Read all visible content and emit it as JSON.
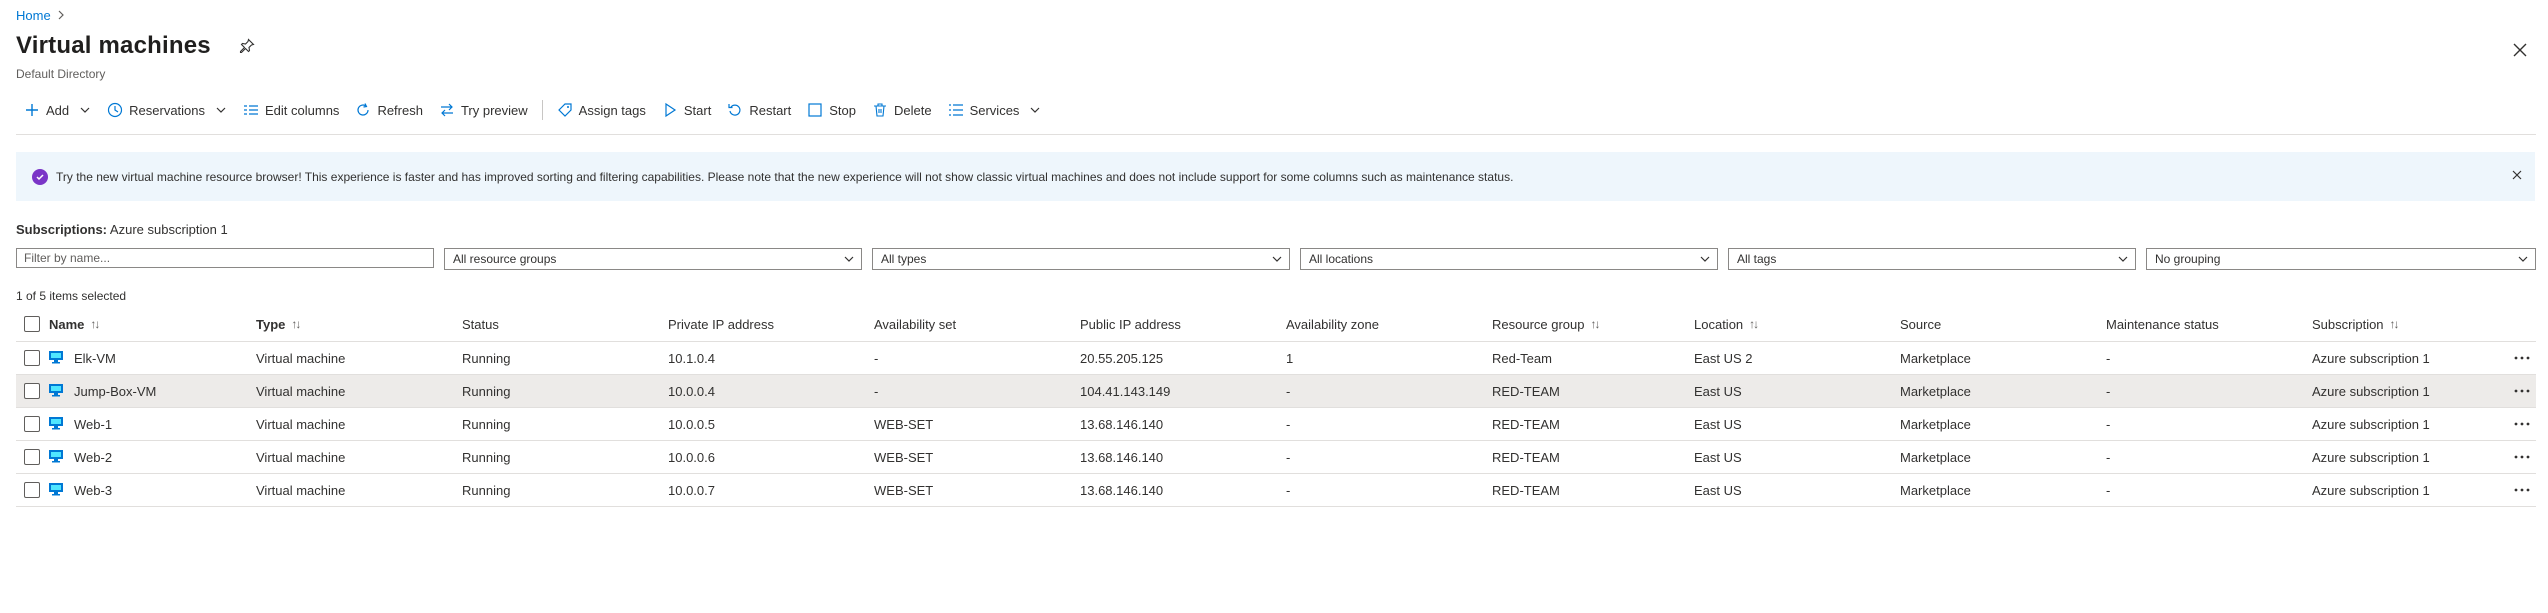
{
  "breadcrumb": {
    "home": "Home"
  },
  "header": {
    "title": "Virtual machines",
    "subtitle": "Default Directory"
  },
  "toolbar": {
    "add": "Add",
    "reservations": "Reservations",
    "edit_columns": "Edit columns",
    "refresh": "Refresh",
    "try_preview": "Try preview",
    "assign_tags": "Assign tags",
    "start": "Start",
    "restart": "Restart",
    "stop": "Stop",
    "delete": "Delete",
    "services": "Services"
  },
  "banner": {
    "text": "Try the new virtual machine resource browser! This experience is faster and has improved sorting and filtering capabilities. Please note that the new experience will not show classic virtual machines and does not include support for some columns such as maintenance status."
  },
  "subscriptions": {
    "label": "Subscriptions:",
    "value": "Azure subscription 1"
  },
  "filters": {
    "name_placeholder": "Filter by name...",
    "resource_groups": "All resource groups",
    "types": "All types",
    "locations": "All locations",
    "tags": "All tags",
    "grouping": "No grouping"
  },
  "selection": {
    "count_text": "1 of 5 items selected"
  },
  "table": {
    "headers": {
      "name": "Name",
      "type": "Type",
      "status": "Status",
      "private_ip": "Private IP address",
      "availability_set": "Availability set",
      "public_ip": "Public IP address",
      "availability_zone": "Availability zone",
      "resource_group": "Resource group",
      "location": "Location",
      "source": "Source",
      "maintenance_status": "Maintenance status",
      "subscription": "Subscription"
    },
    "rows": [
      {
        "name": "Elk-VM",
        "type": "Virtual machine",
        "status": "Running",
        "private_ip": "10.1.0.4",
        "availability_set": "-",
        "public_ip": "20.55.205.125",
        "availability_zone": "1",
        "resource_group": "Red-Team",
        "location": "East US 2",
        "source": "Marketplace",
        "maintenance_status": "-",
        "subscription": "Azure subscription 1"
      },
      {
        "name": "Jump-Box-VM",
        "type": "Virtual machine",
        "status": "Running",
        "private_ip": "10.0.0.4",
        "availability_set": "-",
        "public_ip": "104.41.143.149",
        "availability_zone": "-",
        "resource_group": "RED-TEAM",
        "location": "East US",
        "source": "Marketplace",
        "maintenance_status": "-",
        "subscription": "Azure subscription 1"
      },
      {
        "name": "Web-1",
        "type": "Virtual machine",
        "status": "Running",
        "private_ip": "10.0.0.5",
        "availability_set": "WEB-SET",
        "public_ip": "13.68.146.140",
        "availability_zone": "-",
        "resource_group": "RED-TEAM",
        "location": "East US",
        "source": "Marketplace",
        "maintenance_status": "-",
        "subscription": "Azure subscription 1"
      },
      {
        "name": "Web-2",
        "type": "Virtual machine",
        "status": "Running",
        "private_ip": "10.0.0.6",
        "availability_set": "WEB-SET",
        "public_ip": "13.68.146.140",
        "availability_zone": "-",
        "resource_group": "RED-TEAM",
        "location": "East US",
        "source": "Marketplace",
        "maintenance_status": "-",
        "subscription": "Azure subscription 1"
      },
      {
        "name": "Web-3",
        "type": "Virtual machine",
        "status": "Running",
        "private_ip": "10.0.0.7",
        "availability_set": "WEB-SET",
        "public_ip": "13.68.146.140",
        "availability_zone": "-",
        "resource_group": "RED-TEAM",
        "location": "East US",
        "source": "Marketplace",
        "maintenance_status": "-",
        "subscription": "Azure subscription 1"
      }
    ]
  },
  "colors": {
    "accent": "#0078d4",
    "banner_bg": "#eef6fc",
    "banner_icon": "#7a35c7",
    "selected_row": "#edebe9"
  },
  "icons": [
    "chevron-right-icon",
    "pin-icon",
    "close-icon",
    "plus-icon",
    "chevron-down-icon",
    "clock-icon",
    "columns-icon",
    "refresh-icon",
    "swap-icon",
    "tag-icon",
    "play-icon",
    "restart-icon",
    "stop-icon",
    "trash-icon",
    "list-icon",
    "info-icon",
    "vm-icon",
    "more-icon",
    "sort-icon"
  ]
}
